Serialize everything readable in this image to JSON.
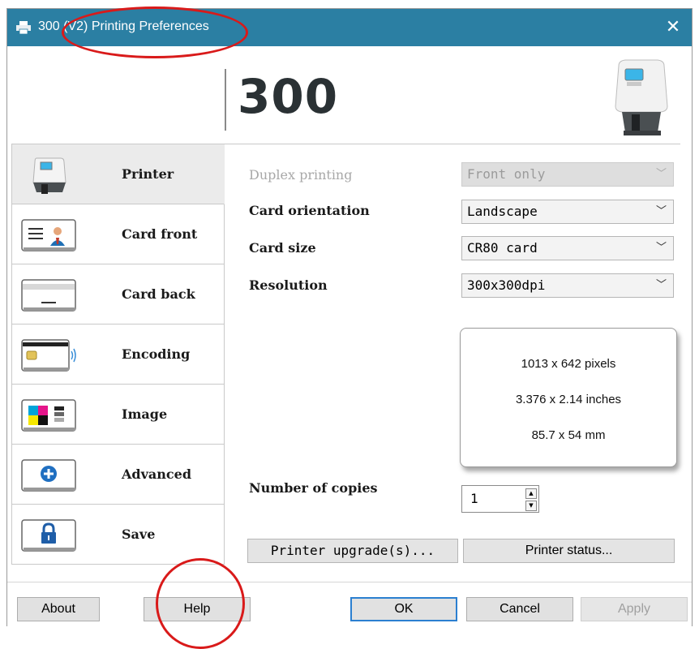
{
  "window": {
    "title": "300 (V2) Printing Preferences",
    "close_label": "✕",
    "logo": "300"
  },
  "sidebar": {
    "items": [
      {
        "label": "Printer",
        "icon": "printer-icon",
        "active": true
      },
      {
        "label": "Card front",
        "icon": "card-front-icon"
      },
      {
        "label": "Card back",
        "icon": "card-back-icon"
      },
      {
        "label": "Encoding",
        "icon": "encoding-icon"
      },
      {
        "label": "Image",
        "icon": "image-icon"
      },
      {
        "label": "Advanced",
        "icon": "advanced-plus-icon"
      },
      {
        "label": "Save",
        "icon": "lock-icon"
      }
    ]
  },
  "settings": {
    "duplex": {
      "label": "Duplex printing",
      "value": "Front only",
      "disabled": true
    },
    "orientation": {
      "label": "Card orientation",
      "value": "Landscape"
    },
    "size": {
      "label": "Card size",
      "value": "CR80 card"
    },
    "resolution": {
      "label": "Resolution",
      "value": "300x300dpi"
    }
  },
  "dimensions": {
    "pixels": "1013 x 642 pixels",
    "inches": "3.376 x 2.14 inches",
    "mm": "85.7 x 54 mm"
  },
  "copies": {
    "label": "Number of copies",
    "value": "1"
  },
  "actions": {
    "upgrade": "Printer upgrade(s)...",
    "status": "Printer status..."
  },
  "footer": {
    "about": "About",
    "help": "Help",
    "ok": "OK",
    "cancel": "Cancel",
    "apply": "Apply"
  },
  "colors": {
    "titlebar": "#2b7fa3",
    "annotation": "#d91a1a",
    "ok_border": "#2b7fd0"
  }
}
